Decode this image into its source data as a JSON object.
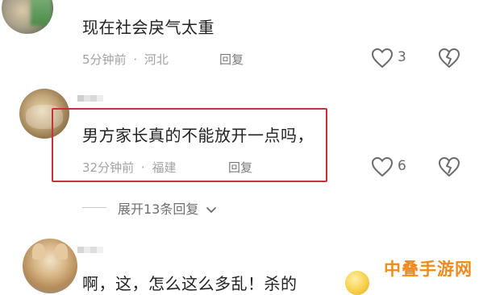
{
  "comments": [
    {
      "text": "现在社会戾气太重",
      "time": "5分钟前",
      "location": "河北",
      "reply_label": "回复",
      "likes": "3"
    },
    {
      "text": "男方家长真的不能放开一点吗，",
      "time": "32分钟前",
      "location": "福建",
      "reply_label": "回复",
      "likes": "6"
    },
    {
      "text": "啊，这，怎么这么多乱！杀的"
    }
  ],
  "expand_replies_label": "展开13条回复",
  "separator": "·",
  "watermark": "中叠手游网",
  "colors": {
    "highlight": "#c4323a",
    "watermark": "#f08a1c"
  },
  "icons": [
    "heart-icon",
    "broken-heart-icon",
    "chevron-down-icon",
    "emoji-icon"
  ]
}
